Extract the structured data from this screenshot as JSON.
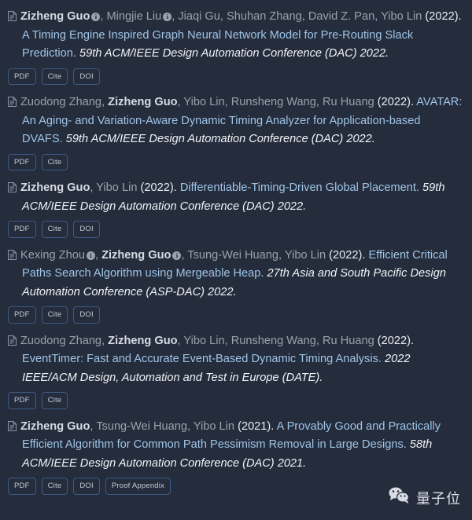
{
  "theme": {
    "background": "#252c3c",
    "author_color": "#9aa2ae",
    "highlight_author_color": "#d6dbe3",
    "title_link_color": "#9fc5e8",
    "venue_color": "#f0f3f7",
    "button_border_color": "#3c5a85",
    "button_text_color": "#c2cad6"
  },
  "icons": {
    "document": "document-icon",
    "info": "info-icon",
    "wechat": "wechat-logo-icon"
  },
  "watermark": {
    "label": "量子位"
  },
  "publications": [
    {
      "authors": [
        {
          "name": "Zizheng Guo",
          "highlight": true,
          "info": true
        },
        {
          "name": "Mingjie Liu",
          "highlight": false,
          "info": true
        },
        {
          "name": "Jiaqi Gu",
          "highlight": false,
          "info": false
        },
        {
          "name": "Shuhan Zhang",
          "highlight": false,
          "info": false
        },
        {
          "name": "David Z. Pan",
          "highlight": false,
          "info": false
        },
        {
          "name": "Yibo Lin",
          "highlight": false,
          "info": false
        }
      ],
      "year": "(2022).",
      "title": "A Timing Engine Inspired Graph Neural Network Model for Pre-Routing Slack Prediction.",
      "venue": "59th ACM/IEEE Design Automation Conference (DAC) 2022.",
      "buttons": [
        "PDF",
        "Cite",
        "DOI"
      ]
    },
    {
      "authors": [
        {
          "name": "Zuodong Zhang",
          "highlight": false,
          "info": false
        },
        {
          "name": "Zizheng Guo",
          "highlight": true,
          "info": false
        },
        {
          "name": "Yibo Lin",
          "highlight": false,
          "info": false
        },
        {
          "name": "Runsheng Wang",
          "highlight": false,
          "info": false
        },
        {
          "name": "Ru Huang",
          "highlight": false,
          "info": false
        }
      ],
      "year": "(2022).",
      "title": "AVATAR: An Aging- and Variation-Aware Dynamic Timing Analyzer for Application-based DVAFS.",
      "venue": "59th ACM/IEEE Design Automation Conference (DAC) 2022.",
      "buttons": [
        "PDF",
        "Cite"
      ]
    },
    {
      "authors": [
        {
          "name": "Zizheng Guo",
          "highlight": true,
          "info": false
        },
        {
          "name": "Yibo Lin",
          "highlight": false,
          "info": false
        }
      ],
      "year": "(2022).",
      "title": "Differentiable-Timing-Driven Global Placement.",
      "venue": "59th ACM/IEEE Design Automation Conference (DAC) 2022.",
      "buttons": [
        "PDF",
        "Cite",
        "DOI"
      ]
    },
    {
      "authors": [
        {
          "name": "Kexing Zhou",
          "highlight": false,
          "info": true
        },
        {
          "name": "Zizheng Guo",
          "highlight": true,
          "info": true
        },
        {
          "name": "Tsung-Wei Huang",
          "highlight": false,
          "info": false
        },
        {
          "name": "Yibo Lin",
          "highlight": false,
          "info": false
        }
      ],
      "year": "(2022).",
      "title": "Efficient Critical Paths Search Algorithm using Mergeable Heap.",
      "venue": "27th Asia and South Pacific Design Automation Conference (ASP-DAC) 2022.",
      "buttons": [
        "PDF",
        "Cite",
        "DOI"
      ]
    },
    {
      "authors": [
        {
          "name": "Zuodong Zhang",
          "highlight": false,
          "info": false
        },
        {
          "name": "Zizheng Guo",
          "highlight": true,
          "info": false
        },
        {
          "name": "Yibo Lin",
          "highlight": false,
          "info": false
        },
        {
          "name": "Runsheng Wang",
          "highlight": false,
          "info": false
        },
        {
          "name": "Ru Huang",
          "highlight": false,
          "info": false
        }
      ],
      "year": "(2022).",
      "title": "EventTimer: Fast and Accurate Event-Based Dynamic Timing Analysis.",
      "venue": "2022 IEEE/ACM Design, Automation and Test in Europe (DATE).",
      "buttons": [
        "PDF",
        "Cite"
      ]
    },
    {
      "authors": [
        {
          "name": "Zizheng Guo",
          "highlight": true,
          "info": false
        },
        {
          "name": "Tsung-Wei Huang",
          "highlight": false,
          "info": false
        },
        {
          "name": "Yibo Lin",
          "highlight": false,
          "info": false
        }
      ],
      "year": "(2021).",
      "title": "A Provably Good and Practically Efficient Algorithm for Common Path Pessimism Removal in Large Designs.",
      "venue": "58th ACM/IEEE Design Automation Conference (DAC) 2021.",
      "buttons": [
        "PDF",
        "Cite",
        "DOI",
        "Proof Appendix"
      ]
    }
  ]
}
